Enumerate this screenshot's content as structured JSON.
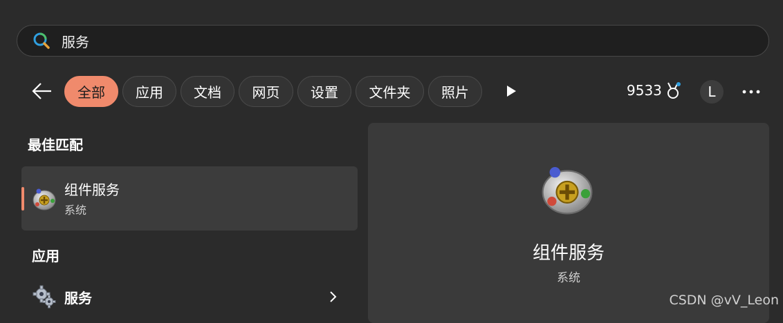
{
  "search": {
    "query": "服务"
  },
  "filters": {
    "chips": [
      {
        "label": "全部",
        "active": true
      },
      {
        "label": "应用",
        "active": false
      },
      {
        "label": "文档",
        "active": false
      },
      {
        "label": "网页",
        "active": false
      },
      {
        "label": "设置",
        "active": false
      },
      {
        "label": "文件夹",
        "active": false
      },
      {
        "label": "照片",
        "active": false
      }
    ]
  },
  "header": {
    "points": "9533",
    "avatar_letter": "L"
  },
  "sections": {
    "best_match": "最佳匹配",
    "apps": "应用"
  },
  "best_match": {
    "title": "组件服务",
    "subtitle": "系统"
  },
  "apps": [
    {
      "label": "服务"
    }
  ],
  "preview": {
    "title": "组件服务",
    "subtitle": "系统"
  },
  "watermark": "CSDN @vV_Leon",
  "colors": {
    "accent": "#f08a6c",
    "background": "#2b2b2b",
    "panel": "#3a3a3a"
  },
  "icons": [
    "search-icon",
    "back-arrow-icon",
    "play-icon",
    "medal-icon",
    "more-icon",
    "component-services-icon",
    "gears-icon",
    "chevron-right-icon"
  ]
}
